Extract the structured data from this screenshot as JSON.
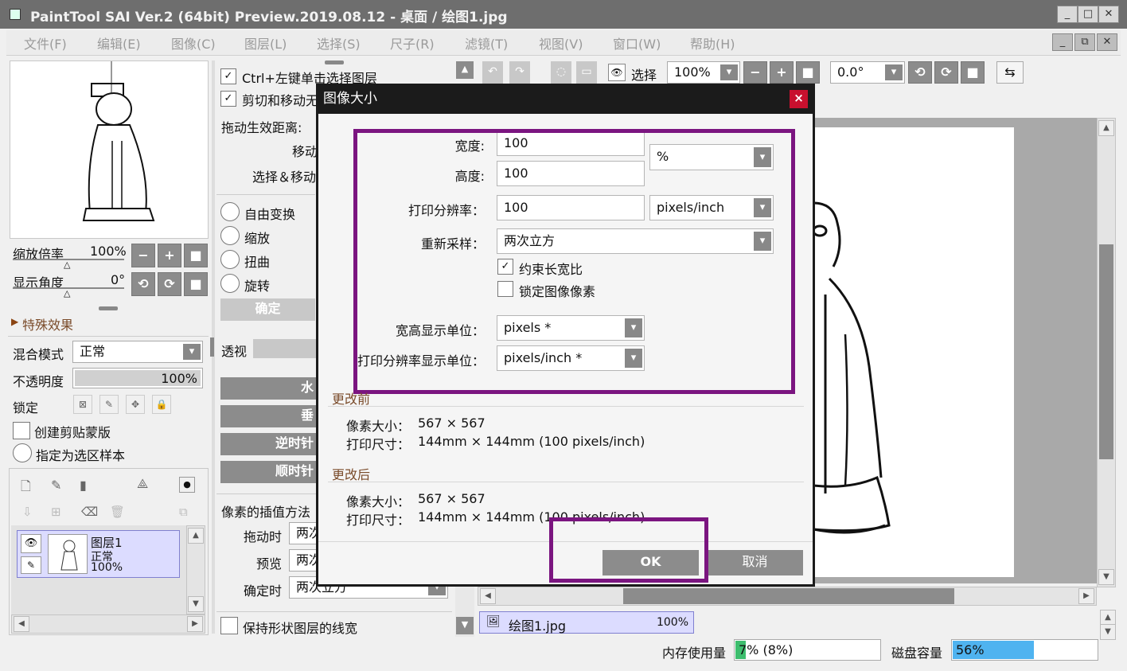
{
  "window": {
    "title": "PaintTool SAI Ver.2 (64bit) Preview.2019.08.12 - 桌面 / 绘图1.jpg",
    "min": "_",
    "max": "□",
    "close": "✕"
  },
  "menu": [
    "文件(F)",
    "编辑(E)",
    "图像(C)",
    "图层(L)",
    "选择(S)",
    "尺子(R)",
    "滤镜(T)",
    "视图(V)",
    "窗口(W)",
    "帮助(H)"
  ],
  "navigator": {
    "zoom_label": "缩放倍率",
    "zoom_value": "100%",
    "angle_label": "显示角度",
    "angle_value": "0°"
  },
  "effects": {
    "label": "特殊效果"
  },
  "layer_props": {
    "blend_label": "混合模式",
    "blend_value": "正常",
    "opacity_label": "不透明度",
    "opacity_value": "100%",
    "opacity_level": 1.0,
    "lock_label": "锁定",
    "clip_label": "创建剪贴蒙版",
    "sample_label": "指定为选区样本"
  },
  "layer": {
    "name": "图层1",
    "mode": "正常",
    "opacity": "100%"
  },
  "tool": {
    "ctrl_click": "Ctrl+左键单击选择图层",
    "cut_move": "剪切和移动无",
    "drag_dist": "拖动生效距离:",
    "move": "移动",
    "select_move": "选择＆移动",
    "free": "自由变换",
    "scale": "缩放",
    "distort": "扭曲",
    "rotate": "旋转",
    "ok": "确定",
    "perspective": "透视",
    "btn_h": "水",
    "btn_v": "垂",
    "btn_ccw": "逆时针",
    "btn_cw": "顺时针",
    "interp": "像素的插值方法",
    "drag_label": "拖动时",
    "drag_value": "两次",
    "preview_label": "预览",
    "preview_value": "两次",
    "confirm_label": "确定时",
    "confirm_value": "两次立方",
    "keep_line": "保持形状图层的线宽"
  },
  "toolbar": {
    "select_label": "选择",
    "zoom": "100%",
    "angle": "0.0°"
  },
  "dialog": {
    "title": "图像大小",
    "close": "×",
    "width_label": "宽度:",
    "width_value": "100",
    "height_label": "高度:",
    "height_value": "100",
    "unit": "%",
    "dpi_label": "打印分辨率：",
    "dpi_value": "100",
    "dpi_unit": "pixels/inch",
    "resample_label": "重新采样：",
    "resample_value": "两次立方",
    "constrain": "约束长宽比",
    "lock_pixels": "锁定图像像素",
    "size_unit_label": "宽高显示单位：",
    "size_unit_value": "pixels *",
    "res_unit_label": "打印分辨率显示单位：",
    "res_unit_value": "pixels/inch *",
    "before": "更改前",
    "after": "更改后",
    "px_label": "像素大小：",
    "px_value": "567 × 567",
    "print_label": "打印尺寸：",
    "print_value": "144mm × 144mm (100 pixels/inch)",
    "ok": "OK",
    "cancel": "取消"
  },
  "doc_tab": {
    "name": "绘图1.jpg",
    "zoom": "100%"
  },
  "status": {
    "mem_label": "内存使用量",
    "mem_value": "7% (8%)",
    "mem_level": 0.07,
    "disk_label": "磁盘容量",
    "disk_value": "56%",
    "disk_level": 0.56
  },
  "colors": {
    "highlight": "#7b1580",
    "disk": "#4fb3f0",
    "mem": "#3dbe6e"
  }
}
